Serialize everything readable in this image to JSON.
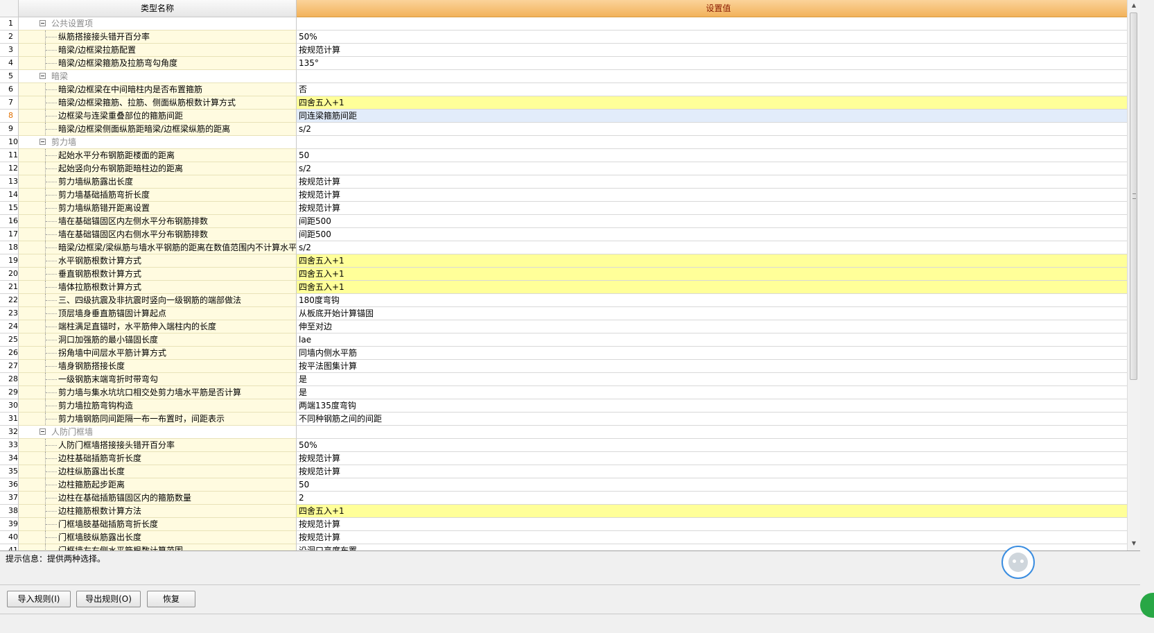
{
  "header": {
    "col_name": "类型名称",
    "col_value": "设置值"
  },
  "rows": [
    {
      "n": "1",
      "name": "公共设置项",
      "value": "",
      "group": true
    },
    {
      "n": "2",
      "name": "纵筋搭接接头错开百分率",
      "value": "50%"
    },
    {
      "n": "3",
      "name": "暗梁/边框梁拉筋配置",
      "value": "按规范计算"
    },
    {
      "n": "4",
      "name": "暗梁/边框梁箍筋及拉筋弯勾角度",
      "value": "135°"
    },
    {
      "n": "5",
      "name": "暗梁",
      "value": "",
      "group": true
    },
    {
      "n": "6",
      "name": "暗梁/边框梁在中间暗柱内是否布置箍筋",
      "value": "否"
    },
    {
      "n": "7",
      "name": "暗梁/边框梁箍筋、拉筋、侧面纵筋根数计算方式",
      "value": "四舍五入+1",
      "highlight": true
    },
    {
      "n": "8",
      "name": "边框梁与连梁重叠部位的箍筋间距",
      "value": "同连梁箍筋间距",
      "selected": true
    },
    {
      "n": "9",
      "name": "暗梁/边框梁侧面纵筋距暗梁/边框梁纵筋的距离",
      "value": "s/2"
    },
    {
      "n": "10",
      "name": "剪力墙",
      "value": "",
      "group": true
    },
    {
      "n": "11",
      "name": "起始水平分布钢筋距楼面的距离",
      "value": "50"
    },
    {
      "n": "12",
      "name": "起始竖向分布钢筋距暗柱边的距离",
      "value": "s/2"
    },
    {
      "n": "13",
      "name": "剪力墙纵筋露出长度",
      "value": "按规范计算"
    },
    {
      "n": "14",
      "name": "剪力墙基础插筋弯折长度",
      "value": "按规范计算"
    },
    {
      "n": "15",
      "name": "剪力墙纵筋错开距离设置",
      "value": "按规范计算"
    },
    {
      "n": "16",
      "name": "墙在基础锚固区内左侧水平分布钢筋排数",
      "value": "间距500"
    },
    {
      "n": "17",
      "name": "墙在基础锚固区内右侧水平分布钢筋排数",
      "value": "间距500"
    },
    {
      "n": "18",
      "name": "暗梁/边框梁/梁纵筋与墙水平钢筋的距离在数值范围内不计算水平钢",
      "value": "s/2"
    },
    {
      "n": "19",
      "name": "水平钢筋根数计算方式",
      "value": "四舍五入+1",
      "highlight": true
    },
    {
      "n": "20",
      "name": "垂直钢筋根数计算方式",
      "value": "四舍五入+1",
      "highlight": true
    },
    {
      "n": "21",
      "name": "墙体拉筋根数计算方式",
      "value": "四舍五入+1",
      "highlight": true
    },
    {
      "n": "22",
      "name": "三、四级抗震及非抗震时竖向一级钢筋的端部做法",
      "value": "180度弯钩"
    },
    {
      "n": "23",
      "name": "顶层墙身垂直筋锚固计算起点",
      "value": "从板底开始计算锚固"
    },
    {
      "n": "24",
      "name": "端柱满足直锚时，水平筋伸入端柱内的长度",
      "value": "伸至对边"
    },
    {
      "n": "25",
      "name": "洞口加强筋的最小锚固长度",
      "value": "lae"
    },
    {
      "n": "26",
      "name": "拐角墙中间层水平筋计算方式",
      "value": "同墙内侧水平筋"
    },
    {
      "n": "27",
      "name": "墙身钢筋搭接长度",
      "value": "按平法图集计算"
    },
    {
      "n": "28",
      "name": "一级钢筋末端弯折时带弯勾",
      "value": "是"
    },
    {
      "n": "29",
      "name": "剪力墙与集水坑坑口相交处剪力墙水平筋是否计算",
      "value": "是"
    },
    {
      "n": "30",
      "name": "剪力墙拉筋弯钩构造",
      "value": "两端135度弯钩"
    },
    {
      "n": "31",
      "name": "剪力墙钢筋同间距隔一布一布置时，间距表示",
      "value": "不同种钢筋之间的间距"
    },
    {
      "n": "32",
      "name": "人防门框墙",
      "value": "",
      "group": true
    },
    {
      "n": "33",
      "name": "人防门框墙搭接接头错开百分率",
      "value": "50%"
    },
    {
      "n": "34",
      "name": "边柱基础插筋弯折长度",
      "value": "按规范计算"
    },
    {
      "n": "35",
      "name": "边柱纵筋露出长度",
      "value": "按规范计算"
    },
    {
      "n": "36",
      "name": "边柱箍筋起步距离",
      "value": "50"
    },
    {
      "n": "37",
      "name": "边柱在基础插筋锚固区内的箍筋数量",
      "value": "2"
    },
    {
      "n": "38",
      "name": "边柱箍筋根数计算方法",
      "value": "四舍五入+1",
      "highlight": true
    },
    {
      "n": "39",
      "name": "门框墙肢基础插筋弯折长度",
      "value": "按规范计算"
    },
    {
      "n": "40",
      "name": "门框墙肢纵筋露出长度",
      "value": "按规范计算"
    },
    {
      "n": "41",
      "name": "门框墙左右侧水平筋根数计算范围",
      "value": "沿洞口高度布置"
    }
  ],
  "hint": "提示信息：提供两种选择。",
  "buttons": {
    "import": "导入规则(I)",
    "export": "导出规则(O)",
    "restore": "恢复"
  }
}
